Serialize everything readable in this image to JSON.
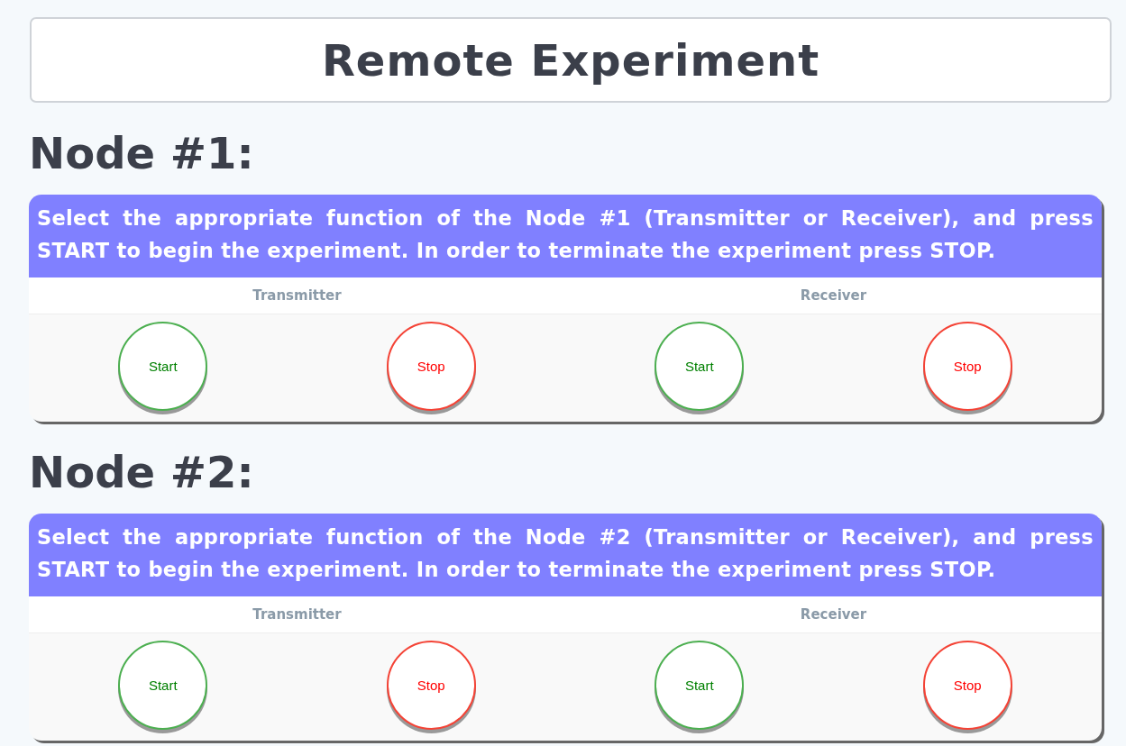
{
  "title": "Remote Experiment",
  "nodes": [
    {
      "heading": "Node #1:",
      "instructions": "Select the appropriate function of the Node #1 (Transmitter or Receiver), and press START to begin the experiment. In order to terminate the experiment press STOP.",
      "roles": [
        {
          "label": "Transmitter",
          "buttons": [
            {
              "kind": "start",
              "label": "Start"
            },
            {
              "kind": "stop",
              "label": "Stop"
            }
          ]
        },
        {
          "label": "Receiver",
          "buttons": [
            {
              "kind": "start",
              "label": "Start"
            },
            {
              "kind": "stop",
              "label": "Stop"
            }
          ]
        }
      ]
    },
    {
      "heading": "Node #2:",
      "instructions": "Select the appropriate function of the Node #2 (Transmitter or Receiver), and press START to begin the experiment. In order to terminate the experiment press STOP.",
      "roles": [
        {
          "label": "Transmitter",
          "buttons": [
            {
              "kind": "start",
              "label": "Start"
            },
            {
              "kind": "stop",
              "label": "Stop"
            }
          ]
        },
        {
          "label": "Receiver",
          "buttons": [
            {
              "kind": "start",
              "label": "Start"
            },
            {
              "kind": "stop",
              "label": "Stop"
            }
          ]
        }
      ]
    }
  ]
}
